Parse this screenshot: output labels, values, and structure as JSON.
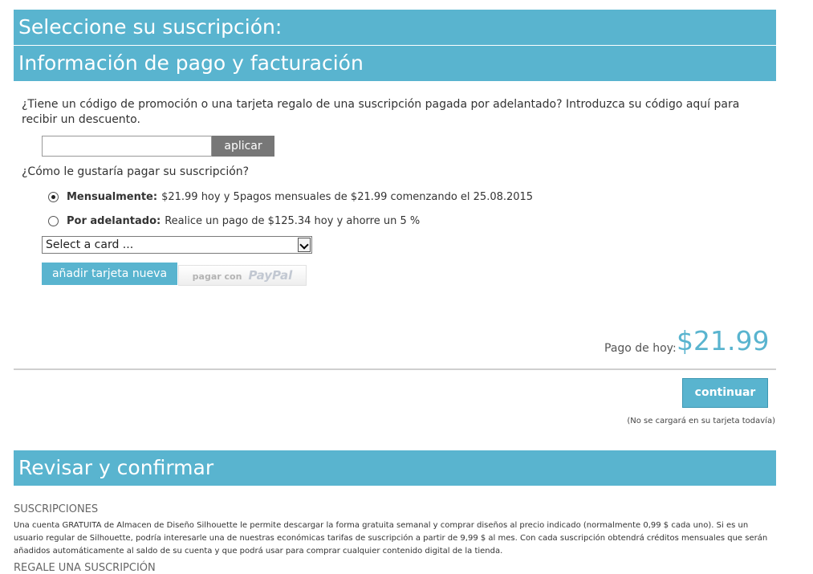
{
  "sections": {
    "subscription_title": "Seleccione su suscripción:",
    "payment_title": "Información de pago y facturación",
    "review_title": "Revisar y confirmar"
  },
  "promo": {
    "text": "¿Tiene un código de promoción o una tarjeta regalo de una suscripción pagada por adelantado? Introduzca su código aquí para recibir un descuento.",
    "input_value": "",
    "apply_label": "aplicar"
  },
  "payment": {
    "question": "¿Cómo le gustaría pagar su suscripción?",
    "options": [
      {
        "label": "Mensualmente:",
        "detail": "$21.99 hoy y 5pagos mensuales de $21.99  comenzando el 25.08.2015",
        "selected": true
      },
      {
        "label": "Por adelantado:",
        "detail": "Realice un pago de $125.34  hoy y ahorre un 5 %",
        "selected": false
      }
    ],
    "card_select": "Select a card ...",
    "add_card_label": "añadir tarjeta nueva",
    "paypal_prefix": "pagar con",
    "paypal_logo": "PayPal"
  },
  "total": {
    "label": "Pago de hoy:",
    "value": "$21.99"
  },
  "continue": {
    "label": "continuar",
    "note": "(No se cargará en su tarjeta todavía)"
  },
  "review": {
    "subs_title": "SUSCRIPCIONES",
    "subs_text": "Una cuenta GRATUITA de Almacen de Diseño Silhouette le permite descargar la forma gratuita semanal y comprar diseños al precio indicado (normalmente 0,99 $ cada uno). Si es un usuario regular de Silhouette, podría interesarle una de nuestras económicas tarifas de suscripción a partir de 9,99 $ al mes. Con cada suscripción obtendrá créditos mensuales que serán añadidos automáticamente al saldo de su cuenta y que podrá usar para comprar cualquier contenido digital de la tienda.",
    "gift_title": "REGALE UNA SUSCRIPCIÓN"
  },
  "colors": {
    "accent": "#59b4cf",
    "button_gray": "#777777"
  }
}
